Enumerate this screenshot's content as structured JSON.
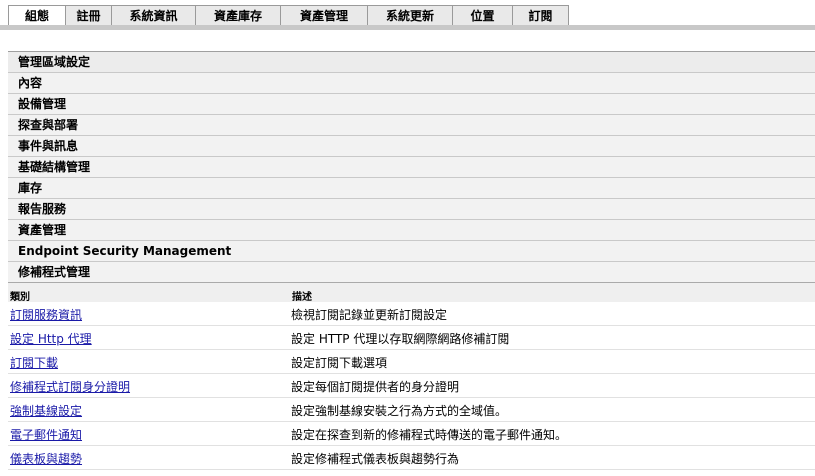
{
  "tabs": [
    {
      "label": "組態",
      "active": true
    },
    {
      "label": "註冊",
      "active": false
    },
    {
      "label": "系統資訊",
      "active": false
    },
    {
      "label": "資產庫存",
      "active": false
    },
    {
      "label": "資產管理",
      "active": false
    },
    {
      "label": "系統更新",
      "active": false
    },
    {
      "label": "位置",
      "active": false
    },
    {
      "label": "訂閱",
      "active": false
    }
  ],
  "sections": {
    "header": "管理區域設定",
    "items": [
      "內容",
      "設備管理",
      "探查與部署",
      "事件與訊息",
      "基礎結構管理",
      "庫存",
      "報告服務",
      "資產管理",
      "Endpoint Security Management",
      "修補程式管理"
    ]
  },
  "table": {
    "headers": [
      "類別",
      "描述"
    ],
    "rows": [
      {
        "category": "訂閱服務資訊",
        "description": "檢視訂閱記錄並更新訂閱設定"
      },
      {
        "category": "設定 Http 代理",
        "description": "設定 HTTP 代理以存取網際網路修補訂閱"
      },
      {
        "category": "訂閱下載",
        "description": "設定訂閱下載選項"
      },
      {
        "category": "修補程式訂閱身分證明",
        "description": "設定每個訂閱提供者的身分證明"
      },
      {
        "category": "強制基線設定",
        "description": "設定強制基線安裝之行為方式的全域值。"
      },
      {
        "category": "電子郵件通知",
        "description": "設定在探查到新的修補程式時傳送的電子郵件通知。"
      },
      {
        "category": "儀表板與趨勢",
        "description": "設定修補程式儀表板與趨勢行為"
      }
    ]
  }
}
